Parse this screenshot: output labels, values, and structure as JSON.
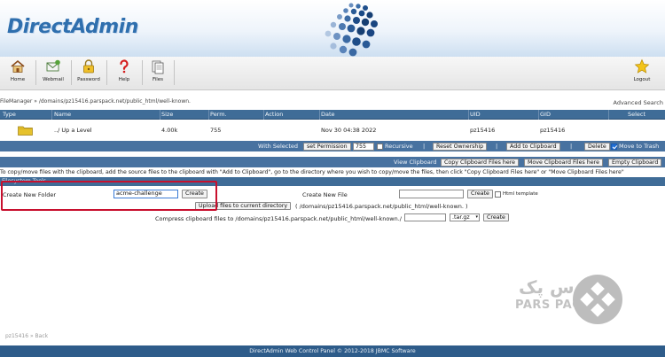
{
  "header": {
    "logo_text": "DirectAdmin",
    "accent_color": "#2f6fae"
  },
  "toolbar": {
    "items": [
      {
        "label": "Home",
        "icon": "home-icon"
      },
      {
        "label": "Webmail",
        "icon": "webmail-icon"
      },
      {
        "label": "Password",
        "icon": "lock-icon"
      },
      {
        "label": "Help",
        "icon": "help-icon"
      },
      {
        "label": "Files",
        "icon": "files-icon"
      }
    ],
    "logout_label": "Logout",
    "logout_icon": "star-icon"
  },
  "breadcrumb": "FileManager » /domains/pz15416.parspack.net/public_html/well-known.",
  "advanced_search_label": "Advanced Search",
  "table": {
    "columns": [
      "Type",
      "Name",
      "Size",
      "Perm.",
      "Action",
      "Date",
      "UID",
      "GID",
      "Select"
    ],
    "rows": [
      {
        "type_icon": "folder-icon",
        "name": "../ Up a Level",
        "size": "4.00k",
        "perm": "755",
        "action": "",
        "date": "Nov 30 04:38 2022",
        "uid": "pz15416",
        "gid": "pz15416"
      }
    ]
  },
  "selected_bar": {
    "label": "With Selected",
    "set_permission_label": "set Permission",
    "permission_value": "755",
    "recursive_label": "Recursive",
    "recursive_checked": false,
    "reset_ownership_label": "Reset Ownership",
    "add_to_clipboard_label": "Add to Clipboard",
    "delete_label": "Delete",
    "move_to_trash_label": "Move to Trash",
    "move_to_trash_checked": true,
    "separator": "|"
  },
  "clipboard_bar": {
    "label": "View Clipboard",
    "copy_label": "Copy Clipboard Files here",
    "move_label": "Move Clipboard Files here",
    "empty_label": "Empty Clipboard"
  },
  "info_text": "To copy/move files with the clipboard, add the source files to the clipboard with \"Add to Clipboard\", go to the directory where you wish to copy/move the files, then click \"Copy Clipboard Files here\" or \"Move Clipboard Files here\"",
  "filesystem_tools": {
    "title": "Filesystem Tools",
    "create_folder_label": "Create New Folder",
    "create_folder_value": "acme-challenge",
    "create_button_label": "Create",
    "create_file_label": "Create New File",
    "create_file_value": "",
    "html_template_label": "Html template",
    "html_template_checked": false,
    "upload_button_label": "Upload files to current directory",
    "upload_path": "( /domains/pz15416.parspack.net/public_html/well-known. )",
    "compress_label": "Compress clipboard files to /domains/pz15416.parspack.net/public_html/well-known./",
    "compress_name_value": "",
    "compress_format": ".tar.gz",
    "compress_button_label": "Create"
  },
  "watermark": {
    "persian_text": "پارس پک",
    "english_text": "PARS PACK"
  },
  "back_link": "pz15416 » Back",
  "footer_text": "DirectAdmin Web Control Panel © 2012-2018 JBMC Software"
}
